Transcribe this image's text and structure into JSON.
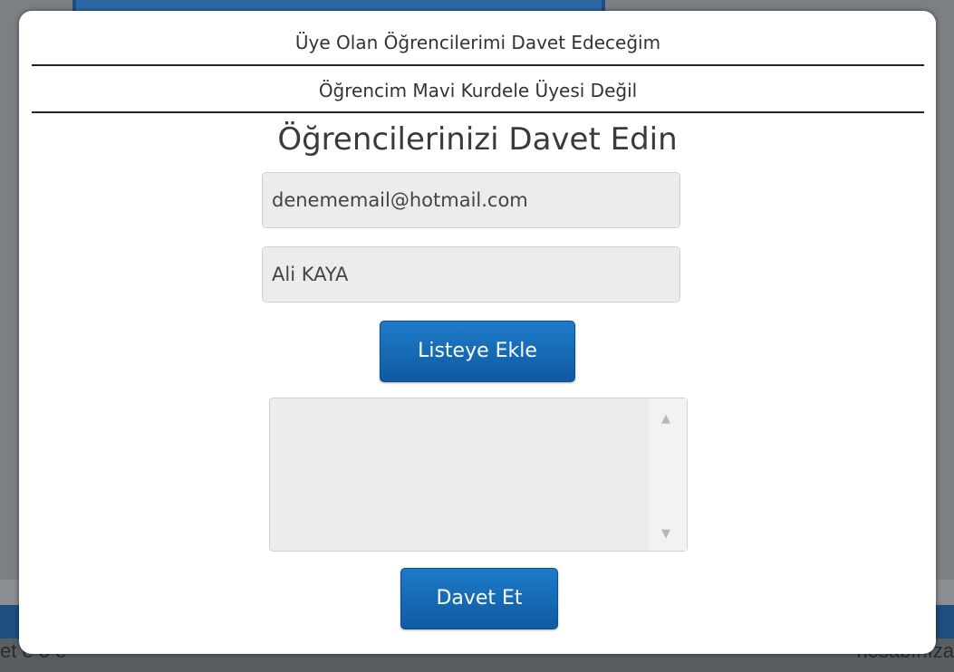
{
  "background": {
    "left_text": "et e o e",
    "right_text": "hesabınıza"
  },
  "modal": {
    "option_member": "Üye Olan Öğrencilerimi Davet Edeceğim",
    "option_not_member": "Öğrencim Mavi Kurdele Üyesi Değil",
    "title": "Öğrencilerinizi Davet Edin",
    "email_value": "denememail@hotmail.com",
    "name_value": "Ali KAYA",
    "add_button": "Listeye Ekle",
    "invite_button": "Davet Et",
    "scroll_up_icon": "▲",
    "scroll_down_icon": "▼"
  },
  "colors": {
    "button": "#1566b3",
    "field_bg": "#ececec"
  }
}
